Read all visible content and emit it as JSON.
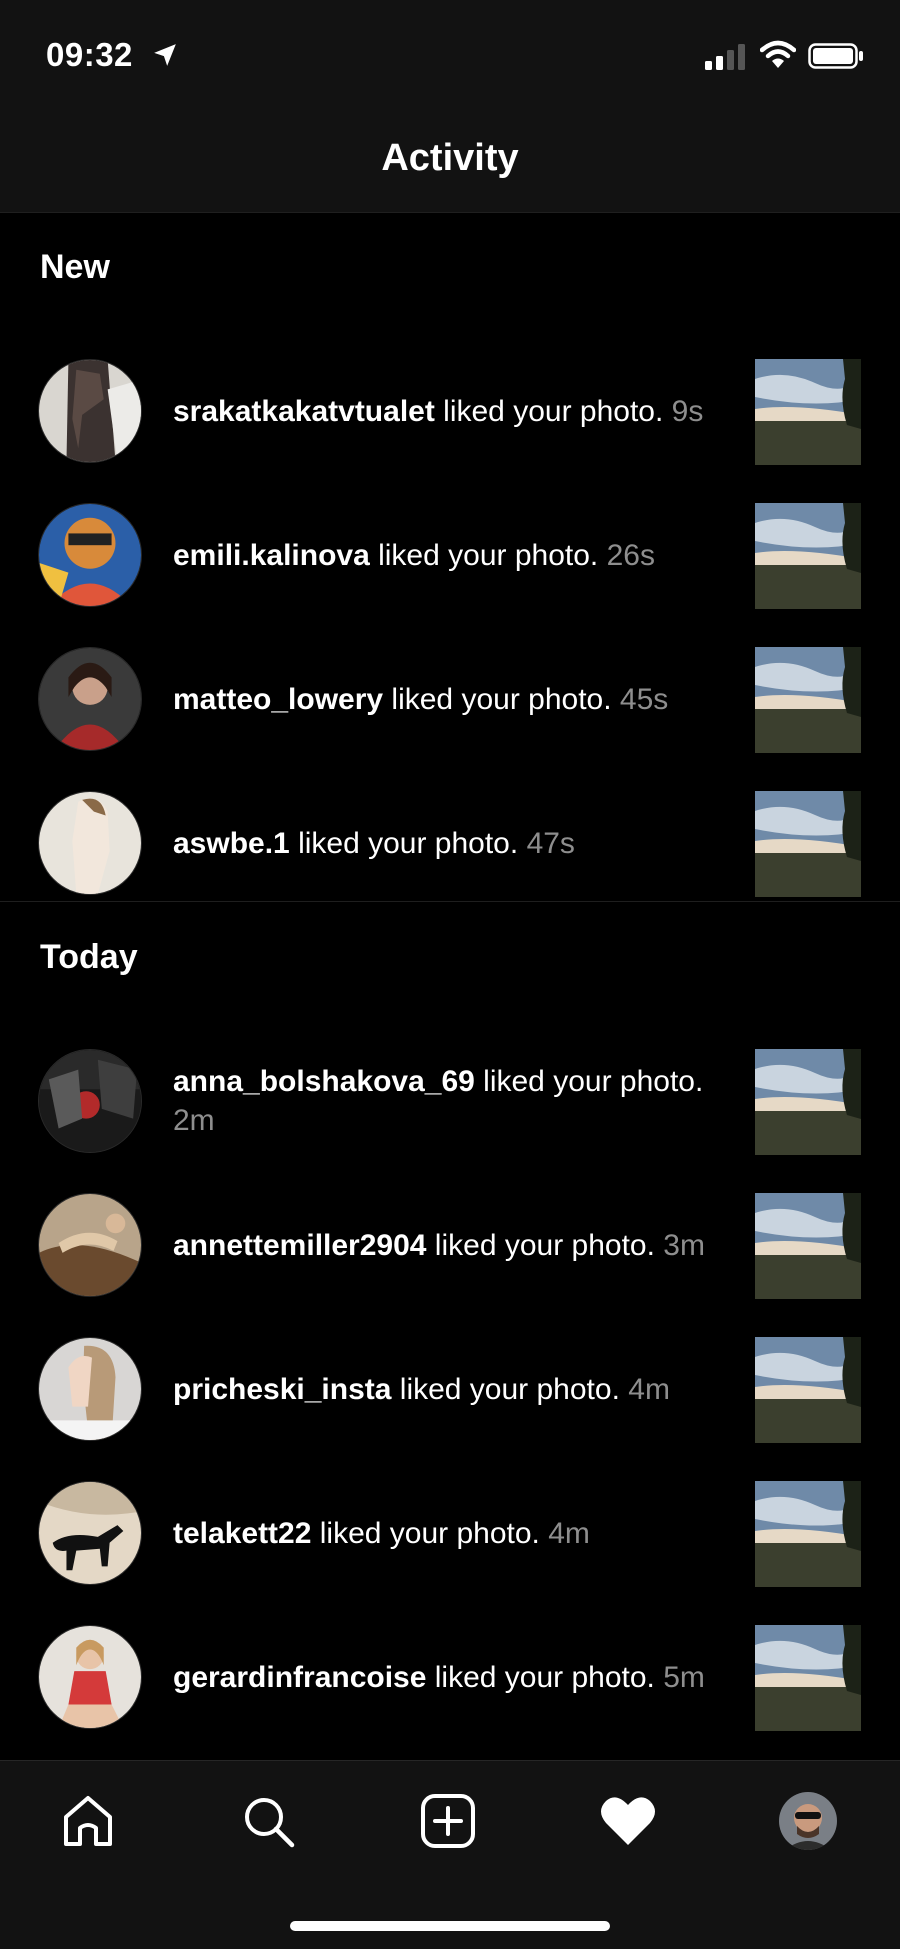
{
  "status_bar": {
    "time": "09:32",
    "icons": [
      "location-arrow-icon",
      "cellular-signal-icon",
      "wifi-icon",
      "battery-icon"
    ]
  },
  "header": {
    "title": "Activity"
  },
  "sections": [
    {
      "title": "New",
      "items": [
        {
          "username": "srakatkakatvtualet",
          "action": " liked your photo.",
          "time": "9s"
        },
        {
          "username": "emili.kalinova",
          "action": " liked your photo.",
          "time": "26s"
        },
        {
          "username": "matteo_lowery",
          "action": " liked your photo.",
          "time": "45s"
        },
        {
          "username": "aswbe.1",
          "action": " liked your photo.",
          "time": "47s"
        }
      ]
    },
    {
      "title": "Today",
      "items": [
        {
          "username": "anna_bolshakova_69",
          "action": " liked your photo.",
          "time": "2m"
        },
        {
          "username": "annettemiller2904",
          "action": " liked your photo.",
          "time": "3m"
        },
        {
          "username": "pricheski_insta",
          "action": " liked your photo.",
          "time": "4m"
        },
        {
          "username": "telakett22",
          "action": " liked your photo.",
          "time": "4m"
        },
        {
          "username": "gerardinfrancoise",
          "action": " liked your photo.",
          "time": "5m"
        }
      ]
    }
  ],
  "tab_bar": {
    "tabs": [
      "home-icon",
      "search-icon",
      "new-post-icon",
      "activity-heart-icon",
      "profile-avatar"
    ],
    "active": "activity-heart-icon"
  },
  "colors": {
    "background": "#000000",
    "bar_background": "#121212",
    "text": "#ffffff",
    "secondary_text": "#8e8e8e"
  }
}
